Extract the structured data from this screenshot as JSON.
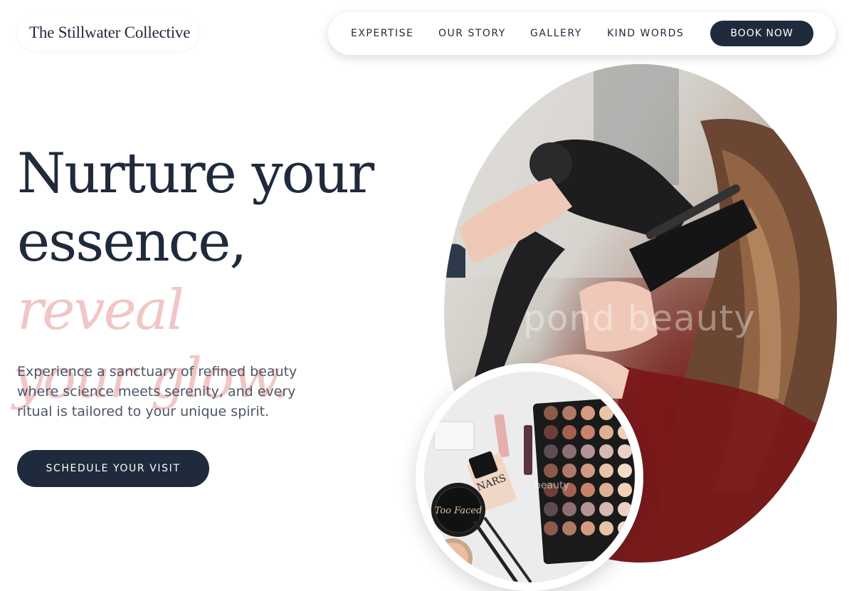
{
  "brand": {
    "name": "The Stillwater Collective"
  },
  "nav": {
    "items": [
      "EXPERTISE",
      "OUR STORY",
      "GALLERY",
      "KIND WORDS"
    ],
    "book_label": "BOOK NOW"
  },
  "hero": {
    "line1": "Nurture your",
    "line2_plain": "essence,",
    "line2_accent": "reveal",
    "line3_accent": "your glow.",
    "subtitle": "Experience a sanctuary of refined beauty where science meets serenity, and every ritual is tailored to your unique spirit.",
    "cta_label": "SCHEDULE YOUR VISIT"
  },
  "images": {
    "main_watermark": "pond beauty",
    "palette_watermark": "beauty",
    "palette_brand_text": "Too Faced",
    "lipstick_brand_text": "NARS"
  },
  "colors": {
    "navy": "#1f2a3c",
    "accent_pink": "#f0c7c6",
    "text_gray": "#4b5563"
  }
}
